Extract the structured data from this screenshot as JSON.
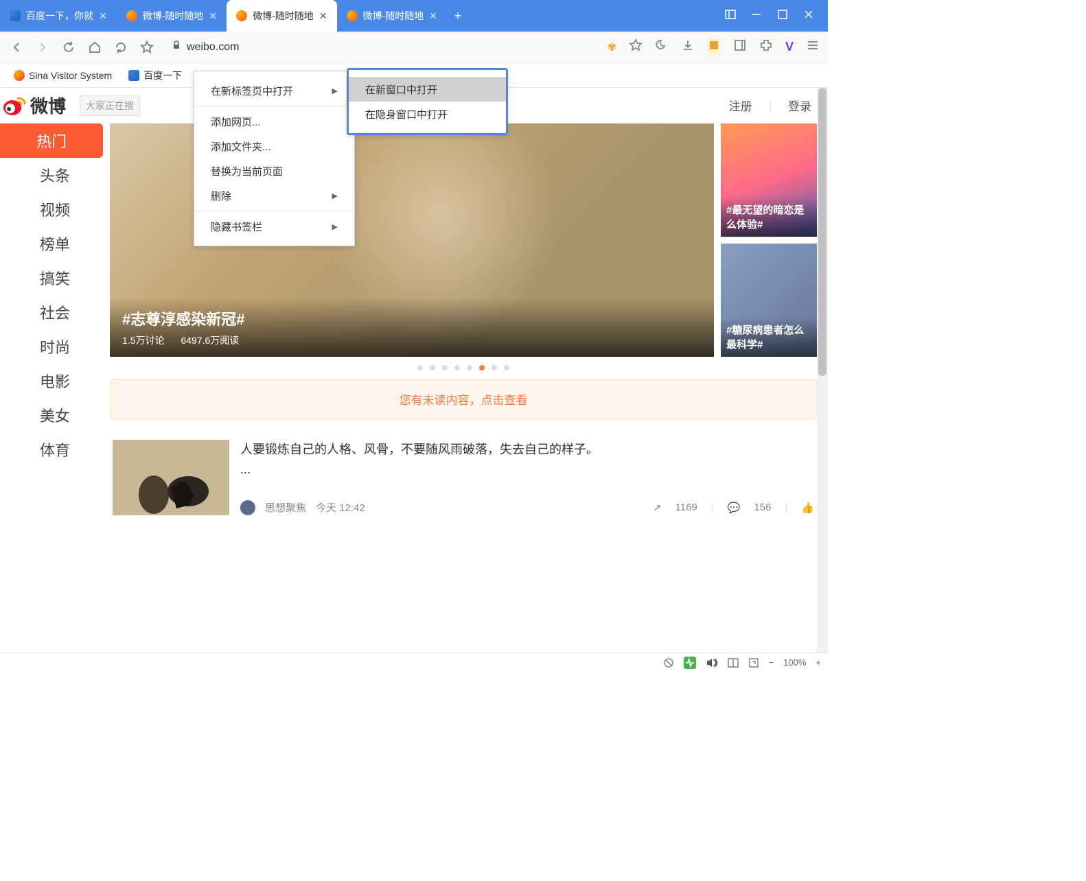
{
  "titlebar": {
    "tabs": [
      {
        "label": "百度一下，你就",
        "favicon": "baidu"
      },
      {
        "label": "微博-随时随地",
        "favicon": "weibo"
      },
      {
        "label": "微博-随时随地",
        "favicon": "weibo",
        "active": true
      },
      {
        "label": "微博-随时随地",
        "favicon": "weibo"
      }
    ]
  },
  "addressbar": {
    "url": "weibo.com"
  },
  "bookmarksbar": {
    "items": [
      {
        "label": "Sina Visitor System",
        "favicon": "sina"
      },
      {
        "label": "百度一下",
        "favicon": "baidu"
      }
    ]
  },
  "context_menu": {
    "items": [
      {
        "label": "在新标签页中打开",
        "submenu": true
      },
      {
        "label": "添加网页...",
        "sep_before": true
      },
      {
        "label": "添加文件夹..."
      },
      {
        "label": "替换为当前页面"
      },
      {
        "label": "删除",
        "submenu": true
      },
      {
        "label": "隐藏书签栏",
        "submenu": true,
        "sep_before": true
      }
    ],
    "submenu": {
      "items": [
        {
          "label": "在新窗口中打开",
          "highlighted": true
        },
        {
          "label": "在隐身窗口中打开"
        }
      ]
    }
  },
  "weibo": {
    "logo_text": "微博",
    "search_placeholder": "大家正在搜",
    "nav": {
      "register": "注册",
      "login": "登录"
    },
    "sidebar": [
      {
        "label": "热门",
        "active": true
      },
      {
        "label": "头条"
      },
      {
        "label": "视频"
      },
      {
        "label": "榜单"
      },
      {
        "label": "搞笑"
      },
      {
        "label": "社会"
      },
      {
        "label": "时尚"
      },
      {
        "label": "电影"
      },
      {
        "label": "美女"
      },
      {
        "label": "体育"
      }
    ],
    "hero": {
      "title": "#志尊淳感染新冠#",
      "discuss": "1.5万讨论",
      "reads": "6497.6万阅读"
    },
    "side_cards": [
      {
        "label": "#最无望的暗恋是么体验#"
      },
      {
        "label": "#糖尿病患者怎么最科学#"
      }
    ],
    "active_dot": 5,
    "dot_count": 8,
    "unread_banner": "您有未读内容，点击查看",
    "post": {
      "text": "人要锻炼自己的人格、风骨，不要随风雨破落，失去自己的样子。 ​​​​",
      "ellipsis": "...",
      "author": "思想聚焦",
      "time": "今天 12:42",
      "repost_count": "1169",
      "comment_count": "156"
    }
  },
  "statusbar": {
    "zoom": "100%"
  }
}
